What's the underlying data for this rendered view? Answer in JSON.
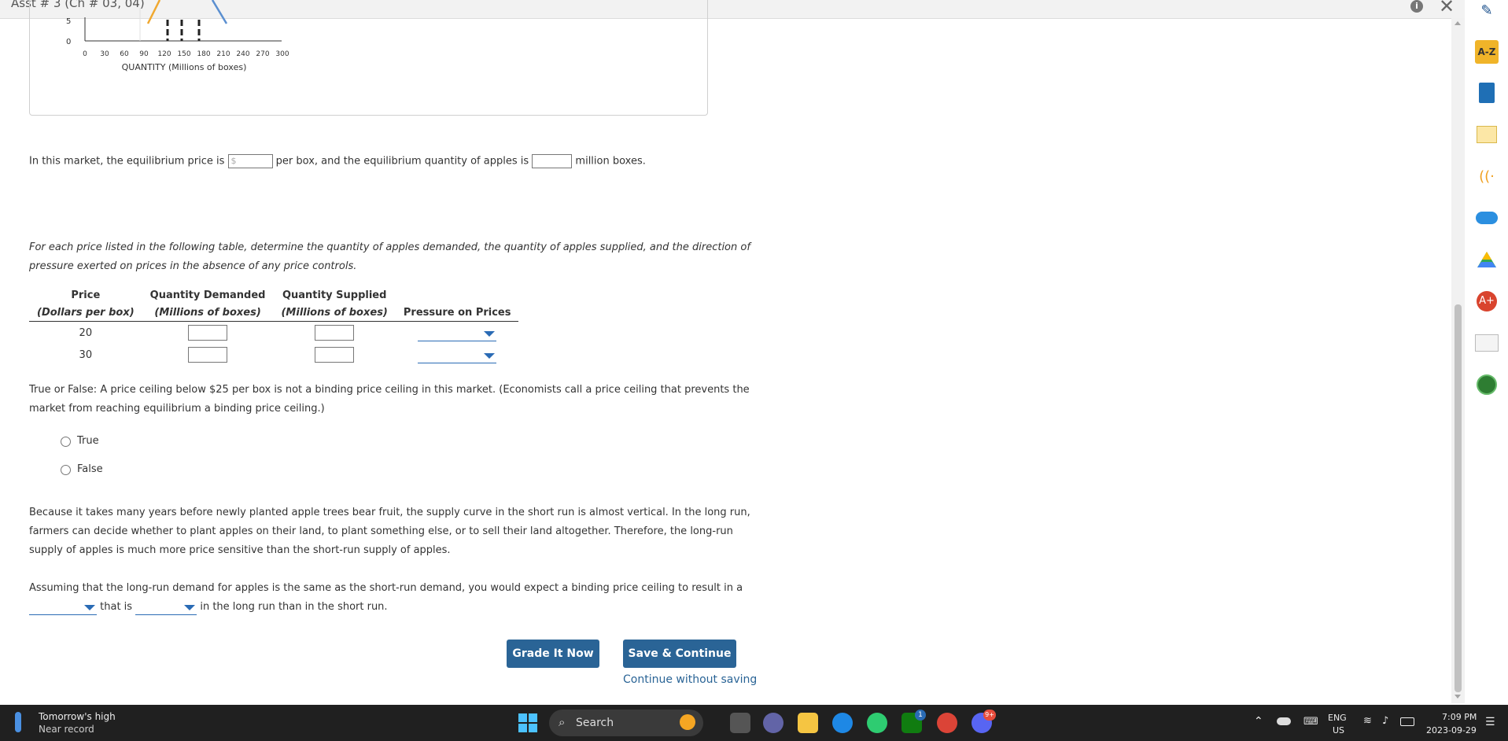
{
  "window": {
    "title": "Asst # 3 (Ch # 03, 04)"
  },
  "graph": {
    "y_ticks": [
      "5",
      "0"
    ],
    "x_ticks": [
      "0",
      "30",
      "60",
      "90",
      "120",
      "150",
      "180",
      "210",
      "240",
      "270",
      "300"
    ],
    "x_label": "QUANTITY (Millions of boxes)"
  },
  "equilibrium": {
    "text1": "In this market, the equilibrium price is",
    "price_placeholder": "$",
    "text2": "per box, and the equilibrium quantity of apples is",
    "text3": "million boxes."
  },
  "table_intro": "For each price listed in the following table, determine the quantity of apples demanded, the quantity of apples supplied, and the direction of pressure exerted on prices in the absence of any price controls.",
  "price_table": {
    "headers": [
      {
        "top": "Price",
        "bottom": "(Dollars per box)"
      },
      {
        "top": "Quantity Demanded",
        "bottom": "(Millions of boxes)"
      },
      {
        "top": "Quantity Supplied",
        "bottom": "(Millions of boxes)"
      },
      {
        "top": "",
        "bottom": "Pressure on Prices"
      }
    ],
    "rows": [
      {
        "price": "20"
      },
      {
        "price": "30"
      }
    ]
  },
  "true_false": {
    "question": "True or False: A price ceiling below $25 per box is not a binding price ceiling in this market. (Economists call a price ceiling that prevents the market from reaching equilibrium a binding price ceiling.)",
    "options": [
      "True",
      "False"
    ]
  },
  "long_run_para": "Because it takes many years before newly planted apple trees bear fruit, the supply curve in the short run is almost vertical. In the long run, farmers can decide whether to plant apples on their land, to plant something else, or to sell their land altogether. Therefore, the long-run supply of apples is much more price sensitive than the short-run supply of apples.",
  "assume": {
    "text1": "Assuming that the long-run demand for apples is the same as the short-run demand, you would expect a binding price ceiling to result in a",
    "text2": "that is",
    "text3": "in the long run than in the short run."
  },
  "buttons": {
    "grade": "Grade It Now",
    "save": "Save & Continue",
    "continue": "Continue without saving"
  },
  "taskbar": {
    "weather_line1": "Tomorrow's high",
    "weather_line2": "Near record",
    "search": "Search",
    "lang1": "ENG",
    "lang2": "US",
    "time": "7:09 PM",
    "date": "2023-09-29",
    "badge_teams": "1",
    "badge_discord": "9+"
  },
  "extensions": [
    "pencil-icon",
    "a-z-icon",
    "book-icon",
    "notes-icon",
    "read-aloud-icon",
    "cloud-icon",
    "drive-icon",
    "a-plus-icon",
    "notepad-icon",
    "circle-icon"
  ],
  "colors": {
    "button": "#2a6496",
    "accent": "#2a6bb5",
    "supply": "#f0a830",
    "demand": "#5b8fd0"
  }
}
